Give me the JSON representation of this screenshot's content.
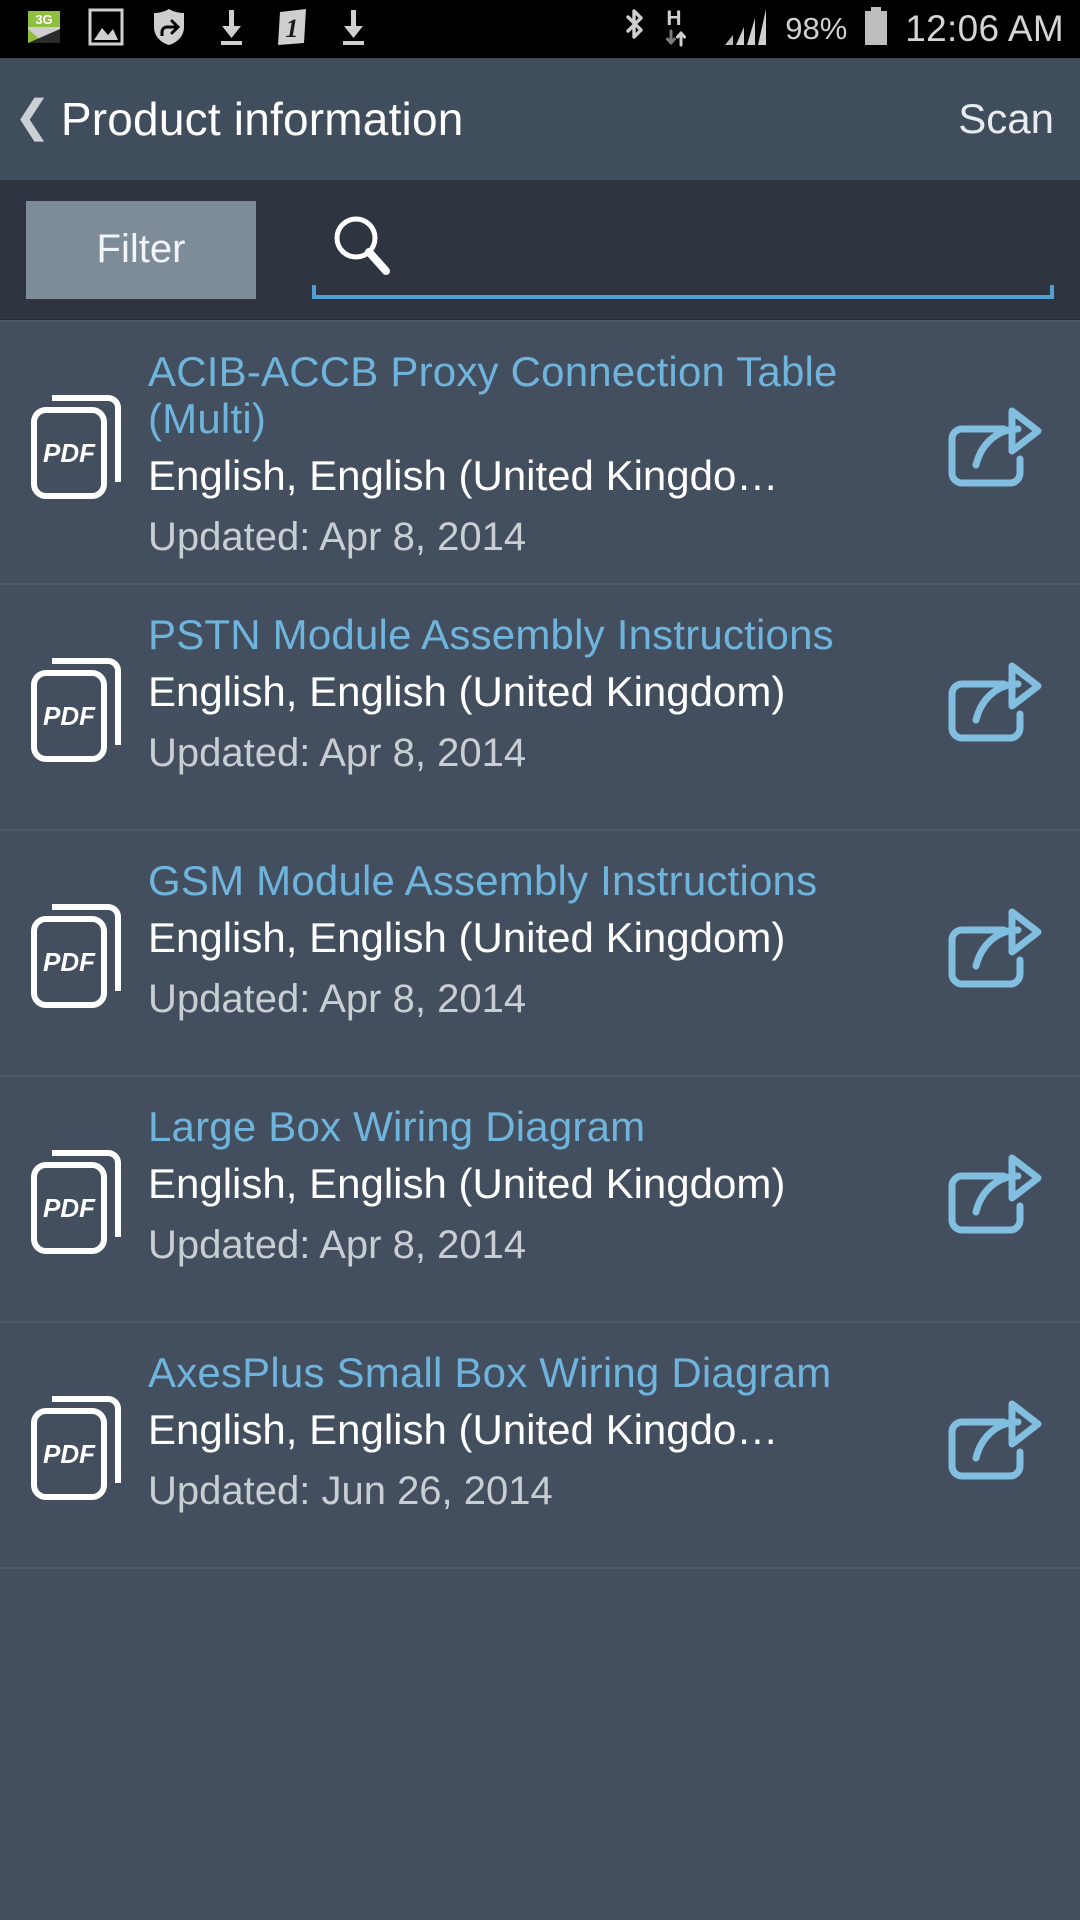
{
  "statusbar": {
    "time": "12:06 AM",
    "battery_percent": "98%",
    "icons_left": [
      "3g-icon",
      "image-icon",
      "shield-sync-icon",
      "download-icon",
      "badge-one-icon",
      "download-icon"
    ],
    "icons_right": [
      "bluetooth-icon",
      "hspa-data-icon",
      "signal-bars-icon",
      "battery-icon"
    ]
  },
  "header": {
    "back_label": "❮",
    "title": "Product information",
    "action_label": "Scan"
  },
  "toolbar": {
    "filter_label": "Filter",
    "search_value": "",
    "search_placeholder": "",
    "search_icon": "search-icon"
  },
  "colors": {
    "status_bar_bg": "#000000",
    "header_bg": "#3F4D5C",
    "toolbar_bg": "#2E3541",
    "list_bg": "#434F5E",
    "filter_button_bg": "#7E8C9A",
    "accent_blue": "#4D9FD4",
    "title_link": "#6FB4DC",
    "divider": "#4E5A69"
  },
  "list": {
    "items": [
      {
        "icon": "pdf-file-icon",
        "title": "ACIB-ACCB Proxy Connection Table (Multi)",
        "languages": "English, English (United Kingdo…",
        "updated": "Updated: Apr 8, 2014",
        "share_icon": "share-icon"
      },
      {
        "icon": "pdf-file-icon",
        "title": "PSTN Module Assembly Instructions",
        "languages": "English, English (United Kingdom)",
        "updated": "Updated: Apr 8, 2014",
        "share_icon": "share-icon"
      },
      {
        "icon": "pdf-file-icon",
        "title": "GSM Module Assembly Instructions",
        "languages": "English, English (United Kingdom)",
        "updated": "Updated: Apr 8, 2014",
        "share_icon": "share-icon"
      },
      {
        "icon": "pdf-file-icon",
        "title": "Large Box Wiring Diagram",
        "languages": "English, English (United Kingdom)",
        "updated": "Updated: Apr 8, 2014",
        "share_icon": "share-icon"
      },
      {
        "icon": "pdf-file-icon",
        "title": "AxesPlus Small Box Wiring Diagram",
        "languages": "English, English (United Kingdo…",
        "updated": "Updated: Jun 26, 2014",
        "share_icon": "share-icon"
      }
    ]
  }
}
